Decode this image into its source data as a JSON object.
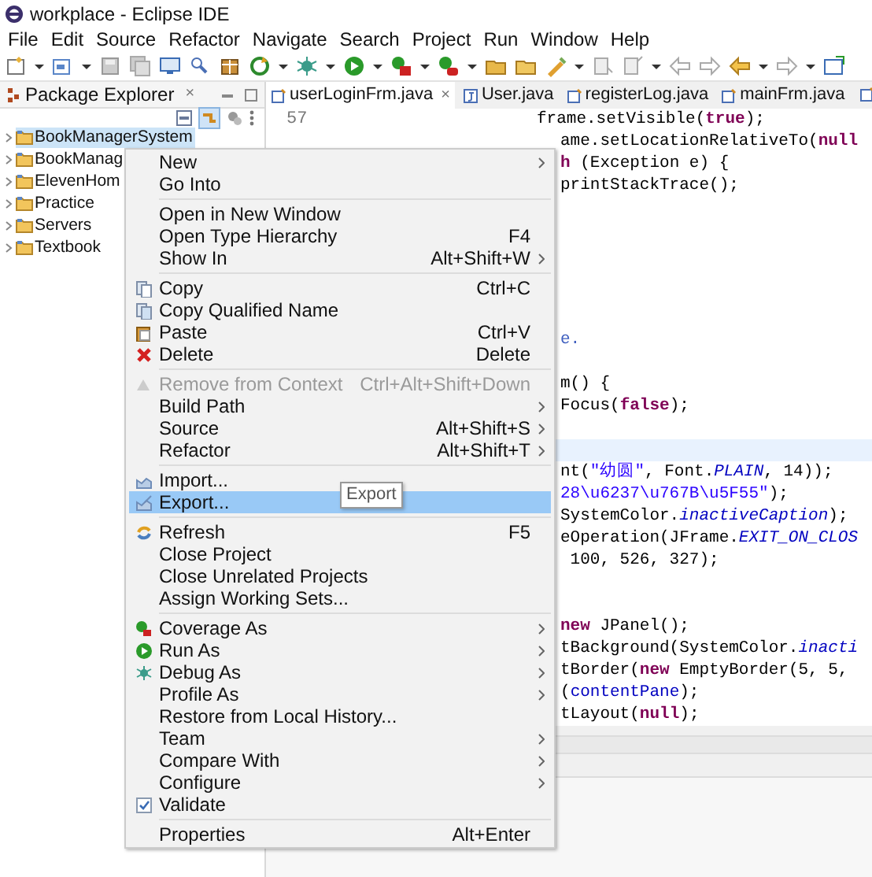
{
  "window": {
    "title": "workplace - Eclipse IDE"
  },
  "menu_bar": [
    "File",
    "Edit",
    "Source",
    "Refactor",
    "Navigate",
    "Search",
    "Project",
    "Run",
    "Window",
    "Help"
  ],
  "package_explorer": {
    "title": "Package Explorer",
    "close": "×",
    "items": [
      {
        "label": "BookManagerSystem",
        "expanded": false,
        "selected": true
      },
      {
        "label": "BookManag",
        "expanded": false,
        "selected": false
      },
      {
        "label": "ElevenHom",
        "expanded": false,
        "selected": false
      },
      {
        "label": "Practice",
        "expanded": false,
        "selected": false
      },
      {
        "label": "Servers",
        "expanded": false,
        "selected": false
      },
      {
        "label": "Textbook",
        "expanded": false,
        "selected": false
      }
    ]
  },
  "editor": {
    "tabs": [
      {
        "label": "userLoginFrm.java",
        "close": "×",
        "selected": true
      },
      {
        "label": "User.java",
        "selected": false
      },
      {
        "label": "registerLog.java",
        "selected": false
      },
      {
        "label": "mainFrm.java",
        "selected": false
      }
    ],
    "line_number": "57",
    "lines": [
      {
        "segments": [
          {
            "text": "frame.setVisible(",
            "kind": "plain"
          },
          {
            "text": "true",
            "kind": "keyword"
          },
          {
            "text": ");",
            "kind": "plain"
          }
        ],
        "current": false
      },
      {
        "segments": [
          {
            "text": "ame.setLocationRelativeTo(",
            "kind": "plain"
          },
          {
            "text": "null",
            "kind": "keyword"
          }
        ],
        "current": false
      },
      {
        "segments": [
          {
            "text": "h",
            "kind": "keyword"
          },
          {
            "text": " (Exception e) {",
            "kind": "plain"
          }
        ],
        "current": false
      },
      {
        "segments": [
          {
            "text": "printStackTrace();",
            "kind": "plain"
          }
        ],
        "current": false
      },
      {
        "current": false
      },
      {
        "current": false
      },
      {
        "current": false
      },
      {
        "current": false
      },
      {
        "current": false
      },
      {
        "current": false
      },
      {
        "segments": [
          {
            "text": "e.",
            "kind": "comment"
          }
        ],
        "current": false
      },
      {
        "current": false
      },
      {
        "segments": [
          {
            "text": "m() {",
            "kind": "plain"
          }
        ],
        "current": false
      },
      {
        "segments": [
          {
            "text": "Focus(",
            "kind": "plain"
          },
          {
            "text": "false",
            "kind": "keyword"
          },
          {
            "text": ");",
            "kind": "plain"
          }
        ],
        "current": false
      },
      {
        "current": false
      },
      {
        "current": true
      },
      {
        "segments": [
          {
            "text": "nt(",
            "kind": "plain"
          },
          {
            "text": "\"幼圆\"",
            "kind": "string"
          },
          {
            "text": ", Font.",
            "kind": "plain"
          },
          {
            "text": "PLAIN",
            "kind": "constant"
          },
          {
            "text": ", 14));",
            "kind": "plain"
          }
        ],
        "current": false
      },
      {
        "segments": [
          {
            "text": "28\\u6237\\u767B\\u5F55\"",
            "kind": "string"
          },
          {
            "text": ");",
            "kind": "plain"
          }
        ],
        "current": false
      },
      {
        "segments": [
          {
            "text": "SystemColor.",
            "kind": "plain"
          },
          {
            "text": "inactiveCaption",
            "kind": "constant"
          },
          {
            "text": ");",
            "kind": "plain"
          }
        ],
        "current": false
      },
      {
        "segments": [
          {
            "text": "eOperation(JFrame.",
            "kind": "plain"
          },
          {
            "text": "EXIT_ON_CLOS",
            "kind": "constant"
          }
        ],
        "current": false
      },
      {
        "segments": [
          {
            "text": " 100, 526, 327);",
            "kind": "plain"
          }
        ],
        "current": false
      },
      {
        "current": false
      },
      {
        "current": false
      },
      {
        "segments": [
          {
            "text": "new",
            "kind": "keyword"
          },
          {
            "text": " JPanel();",
            "kind": "plain"
          }
        ],
        "current": false
      },
      {
        "segments": [
          {
            "text": "tBackground(SystemColor.",
            "kind": "plain"
          },
          {
            "text": "inacti",
            "kind": "constant"
          }
        ],
        "current": false
      },
      {
        "segments": [
          {
            "text": "tBorder(",
            "kind": "plain"
          },
          {
            "text": "new",
            "kind": "keyword"
          },
          {
            "text": " EmptyBorder(5, 5,",
            "kind": "plain"
          }
        ],
        "current": false
      },
      {
        "segments": [
          {
            "text": "(",
            "kind": "plain"
          },
          {
            "text": "contentPane",
            "kind": "field"
          },
          {
            "text": ");",
            "kind": "plain"
          }
        ],
        "current": false
      },
      {
        "segments": [
          {
            "text": "tLayout(",
            "kind": "plain"
          },
          {
            "text": "null",
            "kind": "keyword"
          },
          {
            "text": ");",
            "kind": "plain"
          }
        ],
        "current": false
      }
    ]
  },
  "context_menu": {
    "items": [
      {
        "kind": "item",
        "label": "New",
        "submenu": true,
        "disabled": false,
        "selected": false
      },
      {
        "kind": "item",
        "label": "Go Into",
        "submenu": false,
        "disabled": false,
        "selected": false
      },
      {
        "kind": "separator"
      },
      {
        "kind": "item",
        "label": "Open in New Window",
        "submenu": false,
        "disabled": false,
        "selected": false
      },
      {
        "kind": "item",
        "label": "Open Type Hierarchy",
        "shortcut": "F4",
        "submenu": false,
        "disabled": false,
        "selected": false
      },
      {
        "kind": "item",
        "label": "Show In",
        "shortcut": "Alt+Shift+W",
        "submenu": true,
        "disabled": false,
        "selected": false
      },
      {
        "kind": "separator"
      },
      {
        "kind": "item",
        "label": "Copy",
        "shortcut": "Ctrl+C",
        "submenu": false,
        "disabled": false,
        "selected": false
      },
      {
        "kind": "item",
        "label": "Copy Qualified Name",
        "submenu": false,
        "disabled": false,
        "selected": false
      },
      {
        "kind": "item",
        "label": "Paste",
        "shortcut": "Ctrl+V",
        "submenu": false,
        "disabled": false,
        "selected": false
      },
      {
        "kind": "item",
        "label": "Delete",
        "shortcut": "Delete",
        "submenu": false,
        "disabled": false,
        "selected": false
      },
      {
        "kind": "separator"
      },
      {
        "kind": "item",
        "label": "Remove from Context",
        "shortcut": "Ctrl+Alt+Shift+Down",
        "submenu": false,
        "disabled": true,
        "selected": false
      },
      {
        "kind": "item",
        "label": "Build Path",
        "submenu": true,
        "disabled": false,
        "selected": false
      },
      {
        "kind": "item",
        "label": "Source",
        "shortcut": "Alt+Shift+S",
        "submenu": true,
        "disabled": false,
        "selected": false
      },
      {
        "kind": "item",
        "label": "Refactor",
        "shortcut": "Alt+Shift+T",
        "submenu": true,
        "disabled": false,
        "selected": false
      },
      {
        "kind": "separator"
      },
      {
        "kind": "item",
        "label": "Import...",
        "submenu": false,
        "disabled": false,
        "selected": false
      },
      {
        "kind": "item",
        "label": "Export...",
        "submenu": false,
        "disabled": false,
        "selected": true
      },
      {
        "kind": "separator"
      },
      {
        "kind": "item",
        "label": "Refresh",
        "shortcut": "F5",
        "submenu": false,
        "disabled": false,
        "selected": false
      },
      {
        "kind": "item",
        "label": "Close Project",
        "submenu": false,
        "disabled": false,
        "selected": false
      },
      {
        "kind": "item",
        "label": "Close Unrelated Projects",
        "submenu": false,
        "disabled": false,
        "selected": false
      },
      {
        "kind": "item",
        "label": "Assign Working Sets...",
        "submenu": false,
        "disabled": false,
        "selected": false
      },
      {
        "kind": "separator"
      },
      {
        "kind": "item",
        "label": "Coverage As",
        "submenu": true,
        "disabled": false,
        "selected": false
      },
      {
        "kind": "item",
        "label": "Run As",
        "submenu": true,
        "disabled": false,
        "selected": false
      },
      {
        "kind": "item",
        "label": "Debug As",
        "submenu": true,
        "disabled": false,
        "selected": false
      },
      {
        "kind": "item",
        "label": "Profile As",
        "submenu": true,
        "disabled": false,
        "selected": false
      },
      {
        "kind": "item",
        "label": "Restore from Local History...",
        "submenu": false,
        "disabled": false,
        "selected": false
      },
      {
        "kind": "item",
        "label": "Team",
        "submenu": true,
        "disabled": false,
        "selected": false
      },
      {
        "kind": "item",
        "label": "Compare With",
        "submenu": true,
        "disabled": false,
        "selected": false
      },
      {
        "kind": "item",
        "label": "Configure",
        "submenu": true,
        "disabled": false,
        "selected": false
      },
      {
        "kind": "item",
        "label": "Validate",
        "submenu": false,
        "disabled": false,
        "selected": false
      },
      {
        "kind": "separator"
      },
      {
        "kind": "item",
        "label": "Properties",
        "shortcut": "Alt+Enter",
        "submenu": false,
        "disabled": false,
        "selected": false
      }
    ]
  },
  "tooltip": "Export"
}
